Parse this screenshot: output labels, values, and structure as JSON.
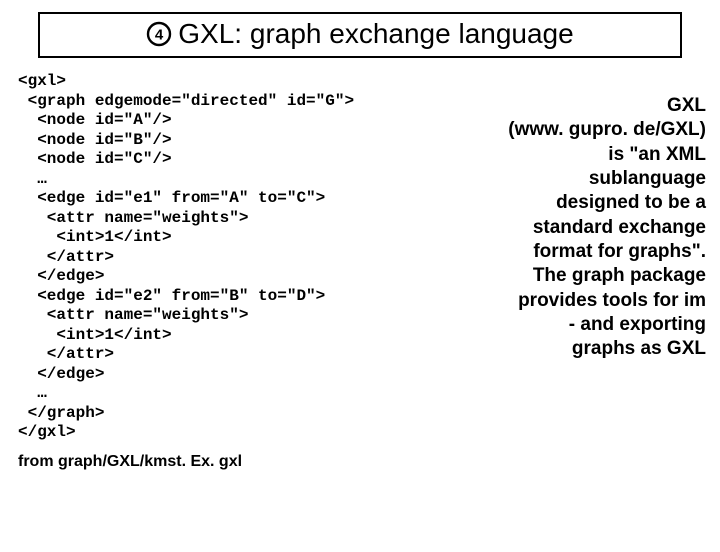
{
  "title": "GXL: graph exchange language",
  "icon": "circled-four-icon",
  "code_lines": [
    "<gxl>",
    " <graph edgemode=\"directed\" id=\"G\">",
    "  <node id=\"A\"/>",
    "  <node id=\"B\"/>",
    "  <node id=\"C\"/>",
    "  …",
    "  <edge id=\"e1\" from=\"A\" to=\"C\">",
    "   <attr name=\"weights\">",
    "    <int>1</int>",
    "   </attr>",
    "  </edge>",
    "  <edge id=\"e2\" from=\"B\" to=\"D\">",
    "   <attr name=\"weights\">",
    "    <int>1</int>",
    "   </attr>",
    "  </edge>",
    "  …",
    " </graph>",
    "</gxl>"
  ],
  "caption": "from graph/GXL/kmst. Ex. gxl",
  "sidebar_lines": [
    "GXL",
    "(www. gupro. de/GXL)",
    "is \"an XML",
    "sublanguage",
    "designed to be a",
    "standard exchange",
    "format for graphs\".",
    "The graph package",
    "provides tools for im",
    "- and exporting",
    "graphs as GXL"
  ]
}
